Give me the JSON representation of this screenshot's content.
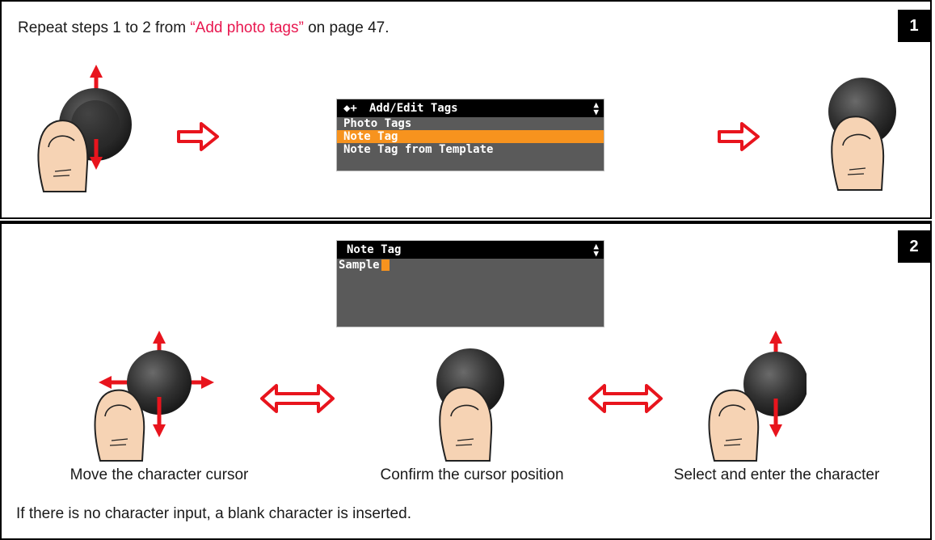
{
  "step1": {
    "number": "1",
    "instruction_prefix": "Repeat steps 1 to 2 from ",
    "instruction_link": "“Add photo tags”",
    "instruction_suffix": " on page 47.",
    "menu": {
      "title": "Add/Edit Tags",
      "items": [
        "Photo Tags",
        "Note Tag",
        "Note Tag from Template"
      ],
      "selected_index": 1
    }
  },
  "step2": {
    "number": "2",
    "screen": {
      "title": "Note Tag",
      "value": "Sample"
    },
    "captions": [
      "Move the character cursor",
      "Confirm the cursor position",
      "Select and enter the character"
    ],
    "note": "If there is no character input, a blank character is inserted."
  },
  "colors": {
    "accent": "#f7931e",
    "arrow": "#e8141d",
    "link": "#e8174f",
    "thumb": "#f6d3b4"
  }
}
